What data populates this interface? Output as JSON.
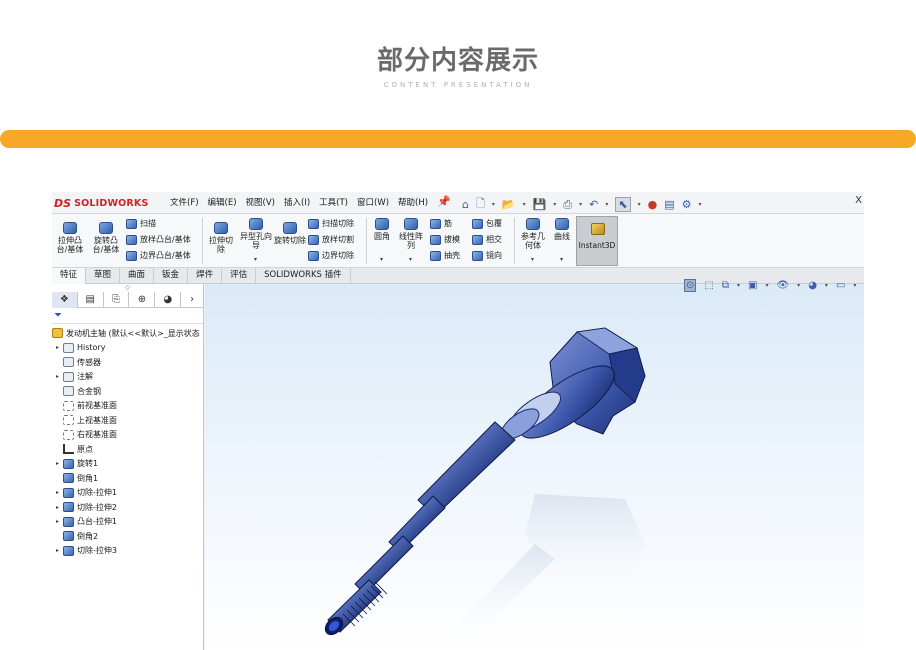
{
  "heading": {
    "title": "部分内容展示",
    "subtitle": "CONTENT PRESENTATION"
  },
  "colors": {
    "accent_bar": "#f7a827",
    "brand_red": "#d32027"
  },
  "solidworks": {
    "logo": {
      "mark": "DS",
      "name": "SOLIDWORKS"
    },
    "menus": [
      "文件(F)",
      "编辑(E)",
      "视图(V)",
      "插入(I)",
      "工具(T)",
      "窗口(W)",
      "帮助(H)"
    ],
    "window_close": "X",
    "ribbon": {
      "extrude_boss": "拉伸凸台/基体",
      "revolve_boss": "旋转凸台/基体",
      "sweep": "扫描",
      "loft": "放样凸台/基体",
      "boundary_boss": "边界凸台/基体",
      "extrude_cut": "拉伸切除",
      "hole_wizard": "异型孔向导",
      "revolve_cut": "旋转切除",
      "swept_cut": "扫描切除",
      "lofted_cut": "放样切割",
      "boundary_cut": "边界切除",
      "fillet": "圆角",
      "linear_pattern": "线性阵列",
      "rib": "筋",
      "draft": "拔模",
      "shell": "抽壳",
      "wrap": "包覆",
      "intersect": "相交",
      "mirror": "镜向",
      "reference_geometry": "参考几何体",
      "curves": "曲线",
      "instant3d": "Instant3D"
    },
    "tabs": [
      "特征",
      "草图",
      "曲面",
      "钣金",
      "焊件",
      "评估",
      "SOLIDWORKS 插件"
    ],
    "tree": {
      "root": "发动机主轴  (默认<<默认>_显示状态",
      "items": [
        "History",
        "传感器",
        "注解",
        "合金钢",
        "前视基准面",
        "上视基准面",
        "右视基准面",
        "原点",
        "旋转1",
        "倒角1",
        "切除-拉伸1",
        "切除-拉伸2",
        "凸台-拉伸1",
        "倒角2",
        "切除-拉伸3"
      ]
    }
  }
}
